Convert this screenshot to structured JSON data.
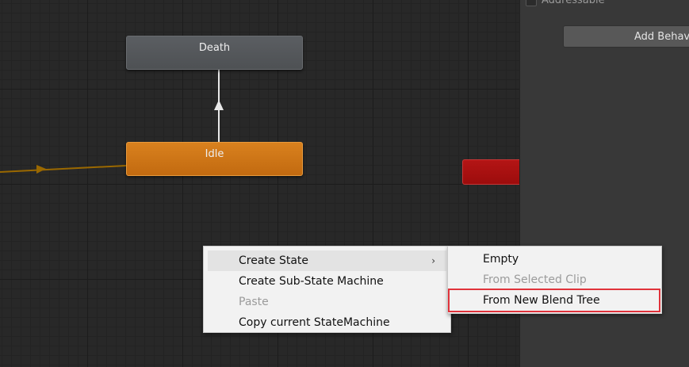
{
  "graph": {
    "nodes": {
      "death": "Death",
      "idle": "Idle"
    },
    "colors": {
      "default_state": "#55585c",
      "entry_state": "#cf7616",
      "exit_state": "#a80f0f",
      "entry_transition": "#9a6800",
      "transition": "#e8e8e8"
    }
  },
  "inspector": {
    "addressable_label": "Addressable",
    "add_behaviour_label": "Add Behaviour"
  },
  "context_menu": {
    "items": [
      {
        "label": "Create State",
        "enabled": true,
        "has_submenu": true,
        "highlighted": true
      },
      {
        "label": "Create Sub-State Machine",
        "enabled": true
      },
      {
        "label": "Paste",
        "enabled": false
      },
      {
        "label": "Copy current StateMachine",
        "enabled": true
      }
    ],
    "submenu_chevron": "›"
  },
  "submenu": {
    "items": [
      {
        "label": "Empty",
        "enabled": true
      },
      {
        "label": "From Selected Clip",
        "enabled": false
      },
      {
        "label": "From New Blend Tree",
        "enabled": true,
        "annotated": true
      }
    ]
  },
  "annotation": {
    "color": "#e0333b"
  }
}
